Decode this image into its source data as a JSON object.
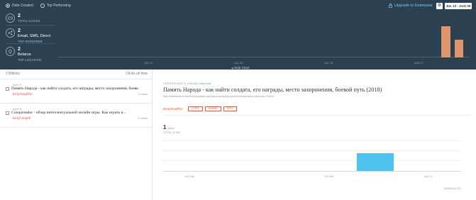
{
  "filters": {
    "date_created": "Date Created",
    "top_performing": "Top Performing"
  },
  "header": {
    "upgrade": "Upgrade to Enterprise",
    "settings_icon": "sliders-icon",
    "date_range": "JUL 10 - AUG 09"
  },
  "stats": [
    {
      "icon": "link-icon",
      "value": "2",
      "label": "TOTAL CLICKS"
    },
    {
      "icon": "share-icon",
      "value": "2",
      "sub": "Email, SMS, Direct",
      "label": "TOP REFERRER"
    },
    {
      "icon": "location-pin-icon",
      "value": "2",
      "sub": "Belarus",
      "label": "TOP LOCATION"
    }
  ],
  "top_chart": {
    "ticks": [
      "JUL 10",
      "JUL 20",
      "JUL 30",
      "AUG 9"
    ],
    "bars": [
      {
        "label": "AUG 8",
        "value": 2
      },
      {
        "label": "AUG 9",
        "value": 1.2
      }
    ],
    "hide_label": "Hide Chart"
  },
  "list": {
    "count": "2 Bitlinks",
    "clicks_all_time": "Clicks all time",
    "items": [
      {
        "date": "AUG 9",
        "title": "Память Народа - как найти солдата, его награды, место захоронения, боеве...",
        "link": "bit.ly/2vwjPbA",
        "clicks": "2 clicks"
      },
      {
        "date": "AUG 8",
        "title": "Conquistador - обзор интеллектуальной онлайн игры. Как играть в...",
        "link": "bit.ly/conq0fr",
        "clicks": "0 clicks"
      }
    ]
  },
  "detail": {
    "created": "CREATED AUG 9, 4:58 AM",
    "user": "serpunar",
    "title": "Память Народа - как найти солдата, его награды, место захоронения, боевой путь (2018)",
    "url": "http://webfacts.ru/reviews/pamyat-naroda-kupnejshij-proekt-ministerstva-oborony-rf.html",
    "short_link": "bit.ly/2vwjPbA",
    "buttons": {
      "copy": "COPY",
      "share": "SHARE",
      "edit": "EDIT"
    },
    "total_value": "1",
    "total_unit": "clicks",
    "total_label": "TOTAL CLICK",
    "chart_ticks": [
      "4:57 AM",
      "7:00 AM",
      "AUG 9"
    ],
    "data_note": "DATA IN UTC"
  }
}
